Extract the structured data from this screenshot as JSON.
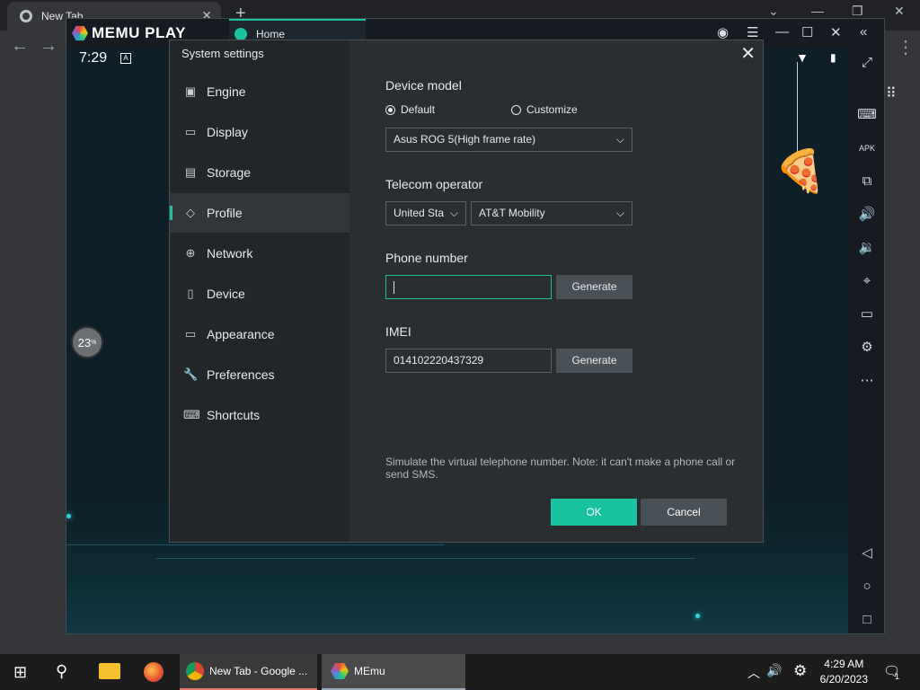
{
  "browser": {
    "tab_title": "New Tab",
    "tab_close": "✕",
    "new_tab": "+"
  },
  "memu": {
    "logo": "MEMU PLAY",
    "home_tab": "Home",
    "android_time": "7:29",
    "android_badge": "A",
    "progress_label": "23",
    "progress_unit": "%"
  },
  "dialog": {
    "title": "System settings",
    "menu": [
      {
        "label": "Engine",
        "icon": "chip-icon"
      },
      {
        "label": "Display",
        "icon": "monitor-icon"
      },
      {
        "label": "Storage",
        "icon": "disk-icon"
      },
      {
        "label": "Profile",
        "icon": "tag-icon"
      },
      {
        "label": "Network",
        "icon": "globe-icon"
      },
      {
        "label": "Device",
        "icon": "phone-icon"
      },
      {
        "label": "Appearance",
        "icon": "window-icon"
      },
      {
        "label": "Preferences",
        "icon": "wrench-icon"
      },
      {
        "label": "Shortcuts",
        "icon": "keyboard-icon"
      }
    ],
    "active_menu": "Profile",
    "device_model": {
      "label": "Device model",
      "option_default": "Default",
      "option_customize": "Customize",
      "selected_option": "Default",
      "model_value": "Asus ROG 5(High frame rate)"
    },
    "telecom": {
      "label": "Telecom operator",
      "country_value": "United Sta",
      "operator_value": "AT&T Mobility"
    },
    "phone": {
      "label": "Phone number",
      "value": "",
      "generate_label": "Generate"
    },
    "imei": {
      "label": "IMEI",
      "value": "014102220437329",
      "generate_label": "Generate"
    },
    "note": "Simulate the virtual telephone number. Note: it can't make a phone call or send SMS.",
    "ok_label": "OK",
    "cancel_label": "Cancel"
  },
  "taskbar": {
    "items": [
      {
        "label": "New Tab - Google ...",
        "icon": "chrome-icon"
      },
      {
        "label": "MEmu",
        "icon": "memu-icon"
      }
    ],
    "time": "4:29 AM",
    "date": "6/20/2023",
    "notification_count": "1"
  },
  "colors": {
    "accent": "#19c3a2",
    "dialog_bg": "#2a2e31"
  }
}
